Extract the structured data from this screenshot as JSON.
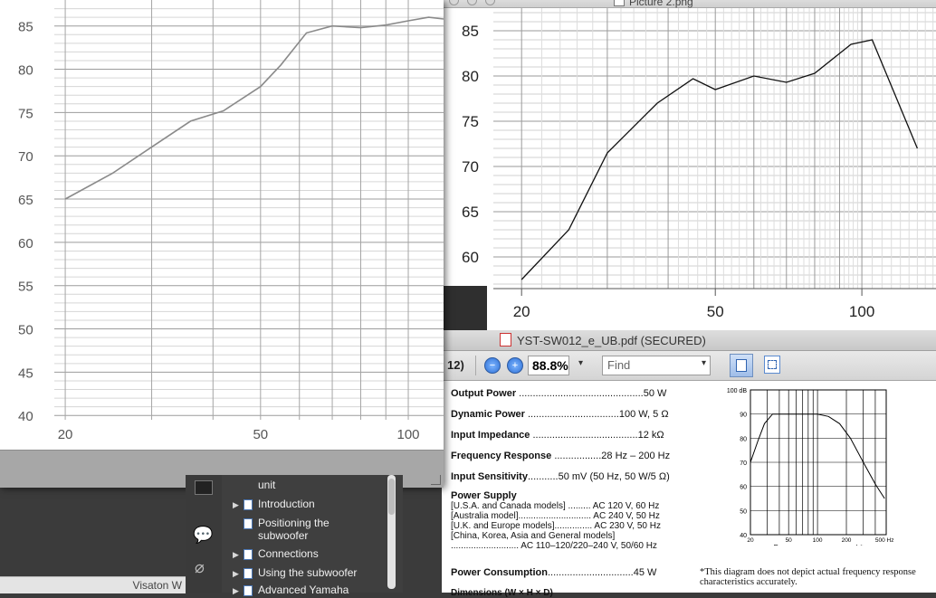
{
  "image_window": {
    "title": "Picture 2.png",
    "graph": {
      "y_ticks": [
        "85",
        "80",
        "75",
        "70",
        "65",
        "60"
      ],
      "x_ticks": [
        "20",
        "50",
        "100"
      ],
      "series_y": [
        {
          "hz": 20,
          "db": 57.5
        },
        {
          "hz": 25,
          "db": 63
        },
        {
          "hz": 30,
          "db": 71.5
        },
        {
          "hz": 38,
          "db": 77
        },
        {
          "hz": 45,
          "db": 79.7
        },
        {
          "hz": 50,
          "db": 78.5
        },
        {
          "hz": 60,
          "db": 80
        },
        {
          "hz": 70,
          "db": 79.3
        },
        {
          "hz": 80,
          "db": 80.3
        },
        {
          "hz": 95,
          "db": 83.5
        },
        {
          "hz": 105,
          "db": 84
        },
        {
          "hz": 130,
          "db": 72
        }
      ]
    }
  },
  "left_window": {
    "y_ticks": [
      "85",
      "80",
      "75",
      "70",
      "65",
      "60",
      "55",
      "50",
      "45",
      "40"
    ],
    "x_ticks": [
      "20",
      "50",
      "100"
    ]
  },
  "pdf_window": {
    "title": "YST-SW012_e_UB.pdf (SECURED)",
    "toolbar": {
      "page_fragment": "12)",
      "zoom": "88.8%",
      "find_placeholder": "Find"
    },
    "specs": [
      {
        "label": "Output Power",
        "dots": " .............................................",
        "value": "50 W"
      },
      {
        "label": "Dynamic Power",
        "dots": " .................................",
        "value": "100 W, 5 Ω"
      },
      {
        "label": "Input Impedance",
        "dots": " ......................................",
        "value": "12 kΩ"
      },
      {
        "label": "Frequency Response",
        "dots": " .................",
        "value": "28 Hz – 200 Hz"
      },
      {
        "label": "Input Sensitivity",
        "dots": "...........",
        "value": "50 mV (50 Hz, 50 W/5 Ω)"
      }
    ],
    "power_supply": {
      "label": "Power Supply",
      "lines": [
        "[U.S.A. and Canada models] ......... AC 120 V, 60 Hz",
        "[Australia model]............................. AC 240 V, 50 Hz",
        "[U.K. and Europe models]............... AC 230 V, 50 Hz",
        "[China, Korea, Asia and General models]",
        "........................... AC 110–120/220–240 V, 50/60 Hz"
      ]
    },
    "power_consumption": {
      "label": "Power Consumption",
      "dots": "...............................",
      "value": "45 W"
    },
    "dimensions_label": "Dimensions (W × H × D)",
    "freq_graph": {
      "caption": "Frequency response graph*",
      "y_ticks": [
        "100 dB",
        "90",
        "80",
        "70",
        "60",
        "50",
        "40"
      ],
      "x_ticks": [
        "20",
        "50",
        "100",
        "200",
        "500 Hz"
      ],
      "note": "*This diagram does not depict actual frequency response characteristics accurately."
    }
  },
  "bookmarks": [
    {
      "label": "unit",
      "has_arrow": false
    },
    {
      "label": "Introduction",
      "has_arrow": true
    },
    {
      "label": "Positioning the subwoofer",
      "has_arrow": false
    },
    {
      "label": "Connections",
      "has_arrow": true
    },
    {
      "label": "Using the subwoofer",
      "has_arrow": true
    },
    {
      "label": "Advanced Yamaha",
      "has_arrow": true
    }
  ],
  "background_window_label": "Visaton W"
}
